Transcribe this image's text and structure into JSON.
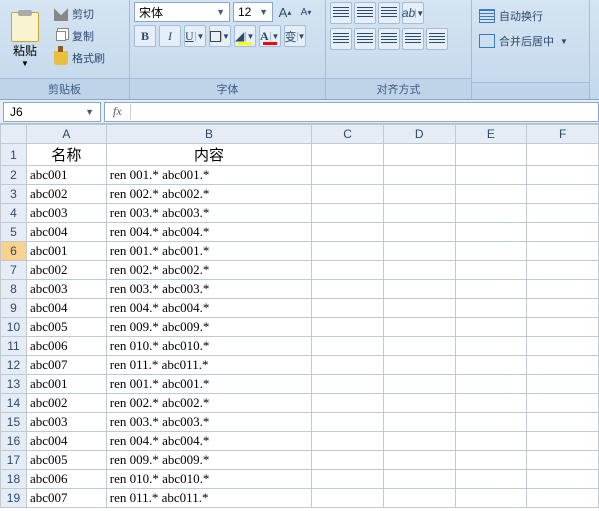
{
  "ribbon": {
    "clipboard": {
      "paste": "粘贴",
      "cut": "剪切",
      "copy": "复制",
      "format_painter": "格式刷",
      "group_label": "剪贴板"
    },
    "font": {
      "name": "宋体",
      "size": "12",
      "bold": "B",
      "italic": "I",
      "underline": "U",
      "grow": "A",
      "shrink": "A",
      "pinyin": "变",
      "group_label": "字体"
    },
    "align": {
      "group_label": "对齐方式"
    },
    "merge": {
      "wrap": "自动换行",
      "merge_center": "合并后居中"
    }
  },
  "name_box": "J6",
  "formula": "",
  "columns": [
    "A",
    "B",
    "C",
    "D",
    "E",
    "F"
  ],
  "header_row": {
    "a": "名称",
    "b": "内容"
  },
  "active_row": 6,
  "rows": [
    {
      "n": 2,
      "a": "abc001",
      "b": "ren 001.* abc001.*"
    },
    {
      "n": 3,
      "a": "abc002",
      "b": "ren 002.* abc002.*"
    },
    {
      "n": 4,
      "a": "abc003",
      "b": "ren 003.* abc003.*"
    },
    {
      "n": 5,
      "a": "abc004",
      "b": "ren 004.* abc004.*"
    },
    {
      "n": 6,
      "a": "abc001",
      "b": "ren 001.* abc001.*"
    },
    {
      "n": 7,
      "a": "abc002",
      "b": "ren 002.* abc002.*"
    },
    {
      "n": 8,
      "a": "abc003",
      "b": "ren 003.* abc003.*"
    },
    {
      "n": 9,
      "a": "abc004",
      "b": "ren 004.* abc004.*"
    },
    {
      "n": 10,
      "a": "abc005",
      "b": "ren 009.* abc009.*"
    },
    {
      "n": 11,
      "a": "abc006",
      "b": "ren 010.* abc010.*"
    },
    {
      "n": 12,
      "a": "abc007",
      "b": "ren 011.* abc011.*"
    },
    {
      "n": 13,
      "a": "abc001",
      "b": "ren 001.* abc001.*"
    },
    {
      "n": 14,
      "a": "abc002",
      "b": "ren 002.* abc002.*"
    },
    {
      "n": 15,
      "a": "abc003",
      "b": "ren 003.* abc003.*"
    },
    {
      "n": 16,
      "a": "abc004",
      "b": "ren 004.* abc004.*"
    },
    {
      "n": 17,
      "a": "abc005",
      "b": "ren 009.* abc009.*"
    },
    {
      "n": 18,
      "a": "abc006",
      "b": "ren 010.* abc010.*"
    },
    {
      "n": 19,
      "a": "abc007",
      "b": "ren 011.* abc011.*"
    }
  ]
}
